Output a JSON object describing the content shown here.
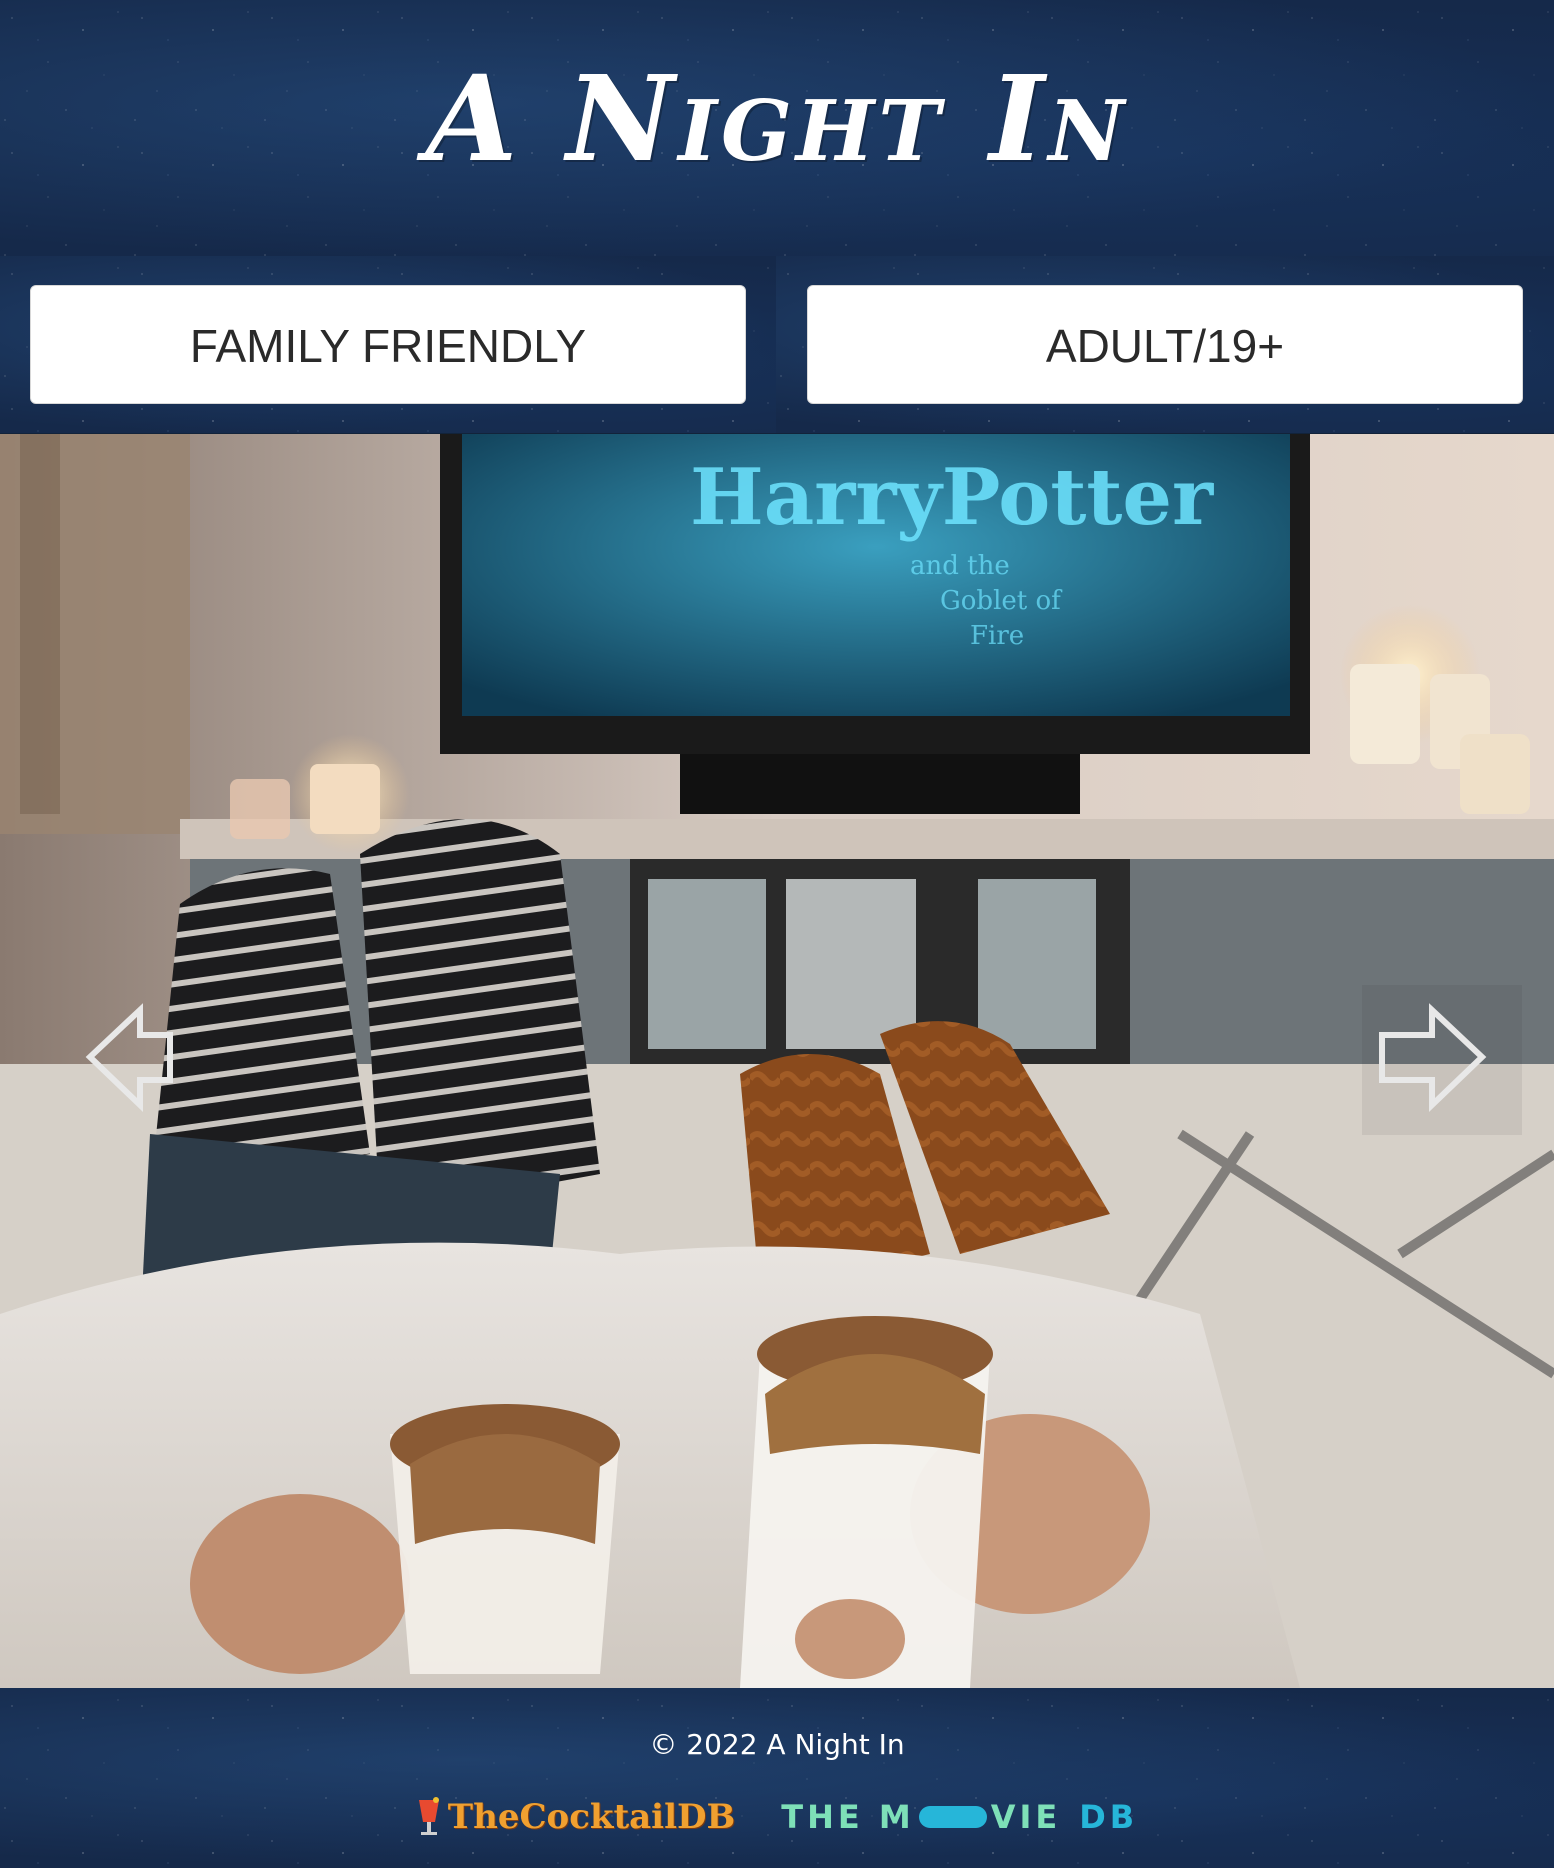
{
  "header": {
    "title": "A Night In"
  },
  "categories": {
    "family_label": "FAMILY FRIENDLY",
    "adult_label": "ADULT/19+"
  },
  "carousel": {
    "prev_icon": "arrow-left-icon",
    "next_icon": "arrow-right-icon"
  },
  "footer": {
    "copyright": "© 2022 A Night In",
    "cocktail_logo": "TheCocktailDB",
    "tmdb_logo_the": "THE M",
    "tmdb_logo_vie": "VIE",
    "tmdb_logo_db": "DB"
  },
  "colors": {
    "background": "#15294a",
    "button_bg": "#ffffff",
    "button_text": "#2a2a2a",
    "cocktail_brand": "#f0a030",
    "tmdb_green": "#7ee0b8",
    "tmdb_blue": "#26b6d9"
  }
}
